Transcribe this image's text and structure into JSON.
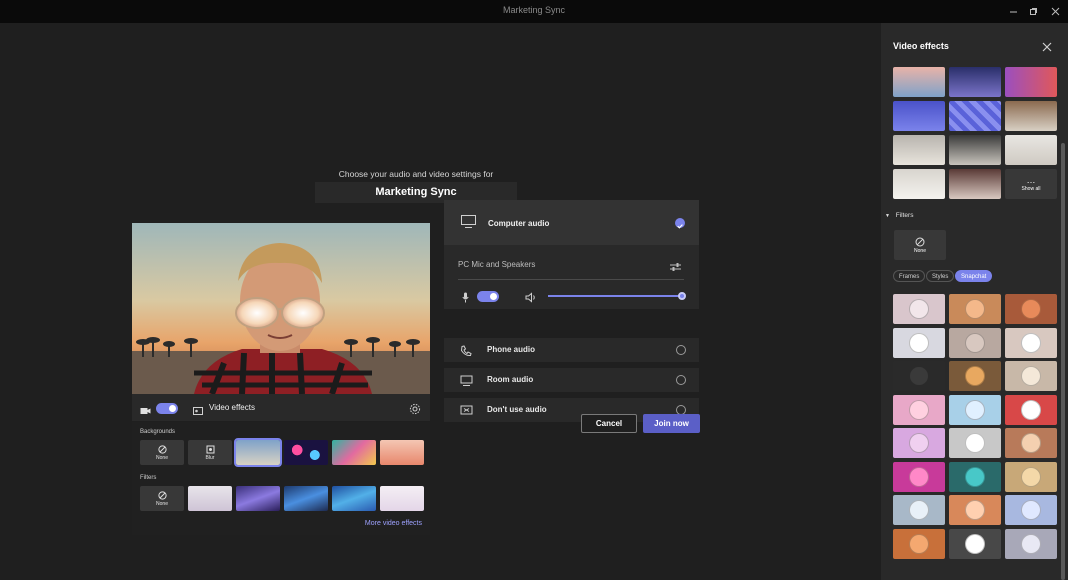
{
  "window": {
    "title": "Marketing Sync"
  },
  "prejoin": {
    "choose_text": "Choose your audio and video settings for",
    "meeting_name": "Marketing Sync"
  },
  "video_controls": {
    "effects_label": "Video effects"
  },
  "effects_panel": {
    "backgrounds_label": "Backgrounds",
    "bg_none_label": "None",
    "bg_blur_label": "Blur",
    "filters_label": "Filters",
    "filter_none_label": "None",
    "more_link": "More video effects"
  },
  "audio": {
    "computer_audio_label": "Computer audio",
    "device_label": "PC Mic and Speakers",
    "volume_level": 1.0,
    "options": [
      {
        "label": "Phone audio"
      },
      {
        "label": "Room audio"
      },
      {
        "label": "Don't use audio"
      }
    ]
  },
  "buttons": {
    "cancel": "Cancel",
    "join": "Join now"
  },
  "side_panel": {
    "title": "Video effects",
    "show_all_label": "Show all",
    "filters_header": "Filters",
    "filter_none_label": "None",
    "tabs": [
      {
        "label": "Frames"
      },
      {
        "label": "Styles"
      },
      {
        "label": "Snapchat"
      }
    ],
    "active_tab": "Snapchat"
  },
  "colors": {
    "accent": "#7b83eb",
    "join_button": "#5b5fc7",
    "background": "#1f1f1f",
    "panel": "#292929"
  }
}
